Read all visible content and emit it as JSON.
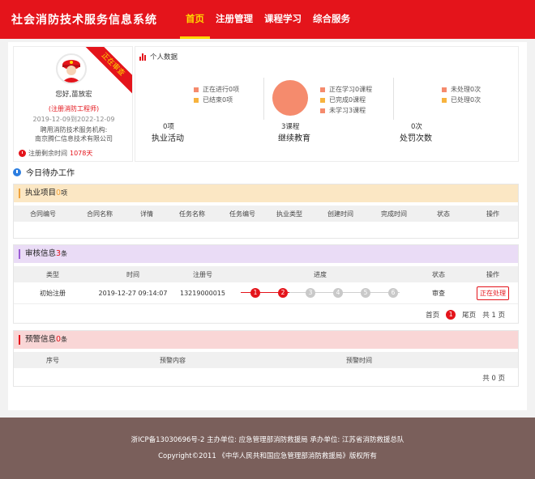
{
  "header": {
    "logo": "社会消防技术服务信息系统",
    "nav": [
      "首页",
      "注册管理",
      "课程学习",
      "综合服务"
    ]
  },
  "profile": {
    "ribbon": "正在审查",
    "greeting": "您好,苗放宏",
    "title": "(注册消防工程师)",
    "dates": "2019-12-09到2022-12-09",
    "org_label": "聘用消防技术服务机构:",
    "org_name": "南京腾仁信息技术有限公司",
    "time_label": "注册剩余时间",
    "time_value": "1078天"
  },
  "stats": {
    "title": "个人数据",
    "practice": {
      "count": "0项",
      "label": "执业活动",
      "legend": [
        "正在进行0项",
        "已结束0项"
      ]
    },
    "education": {
      "count": "3课程",
      "label": "继续教育",
      "legend": [
        "正在学习0课程",
        "已完成0课程",
        "未学习3课程"
      ]
    },
    "penalty": {
      "count": "0次",
      "label": "处罚次数",
      "legend": [
        "未处理0次",
        "已处理0次"
      ]
    },
    "colors": {
      "red": "#f58b6d",
      "orange": "#f7b33e",
      "pie": "#f58b6d"
    }
  },
  "todo": {
    "title": "今日待办工作"
  },
  "practice_section": {
    "title": "执业项目",
    "count": "0",
    "unit": "项",
    "columns": [
      "合同编号",
      "合同名称",
      "详情",
      "任务名称",
      "任务编号",
      "执业类型",
      "创建时间",
      "完成时间",
      "状态",
      "操作"
    ]
  },
  "review_section": {
    "title": "审核信息",
    "count": "3",
    "unit": "条",
    "columns": [
      "类型",
      "时间",
      "注册号",
      "进度",
      "状态",
      "操作"
    ],
    "row": {
      "type": "初始注册",
      "time": "2019-12-27 09:14:07",
      "reg_no": "13219000015",
      "steps": [
        "1",
        "2",
        "3",
        "4",
        "5",
        "6"
      ],
      "completed_steps": 2,
      "status": "审查",
      "action": "正在处理"
    },
    "pager": {
      "first": "首页",
      "page": "1",
      "last": "尾页",
      "total": "共 1 页"
    }
  },
  "warning_section": {
    "title": "预警信息",
    "count": "0",
    "unit": "条",
    "columns": [
      "序号",
      "预警内容",
      "预警时间"
    ],
    "total": "共 0 页"
  },
  "footer": {
    "line1": "浙ICP备13030696号-2  主办单位: 应急管理部消防救援局  承办单位: 江苏省消防救援总队",
    "line2": "Copyright©2011 《中华人民共和国应急管理部消防救援局》版权所有"
  }
}
